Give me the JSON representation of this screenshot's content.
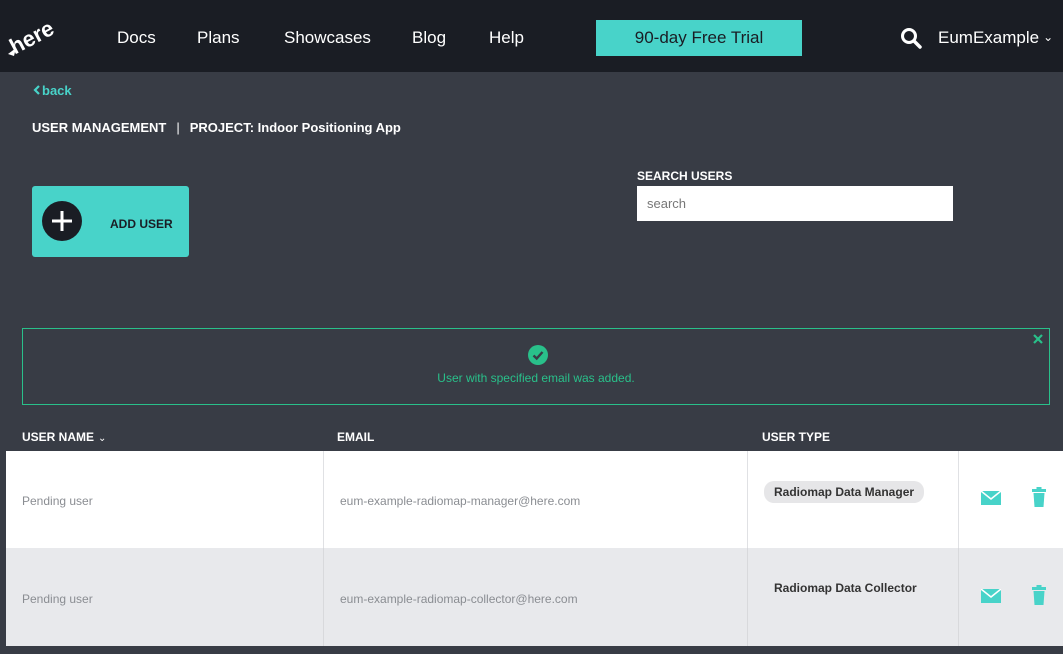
{
  "nav": {
    "logo_text": "here",
    "links": [
      "Docs",
      "Plans",
      "Showcases",
      "Blog",
      "Help"
    ],
    "trial_label": "90-day Free Trial",
    "user_label": "EumExample",
    "search_icon": "search-icon"
  },
  "header": {
    "back_label": "back",
    "section": "USER MANAGEMENT",
    "separator": "|",
    "project": "PROJECT: Indoor Positioning App",
    "add_user_label": "ADD USER",
    "search_label": "SEARCH USERS",
    "search_placeholder": "search"
  },
  "alert": {
    "message": "User with specified email was added.",
    "close_symbol": "×"
  },
  "table": {
    "headers": {
      "name": "USER NAME",
      "email": "EMAIL",
      "type": "USER TYPE"
    },
    "rows": [
      {
        "name": "Pending user",
        "email": "eum-example-radiomap-manager@here.com",
        "type": "Radiomap Data Manager"
      },
      {
        "name": "Pending user",
        "email": "eum-example-radiomap-collector@here.com",
        "type": "Radiomap Data Collector"
      }
    ]
  },
  "colors": {
    "accent": "#48d3c9",
    "success": "#29c08a",
    "nav_bg": "#1a1d24",
    "page_bg": "#383c45"
  }
}
